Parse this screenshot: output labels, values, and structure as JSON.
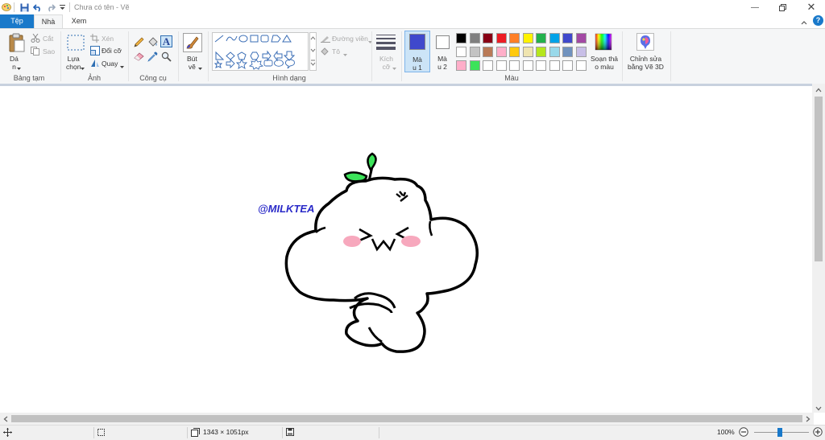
{
  "app": {
    "title": "Chưa có tên - Vẽ",
    "tabs": [
      "Tệp",
      "Nhà",
      "Xem"
    ]
  },
  "ribbon": {
    "clipboard": {
      "paste": "Dá\nn",
      "cut": "Cắt",
      "copy": "Sao",
      "group": "Bảng tạm"
    },
    "image": {
      "select": "Lựa\nchọn",
      "crop": "Xén",
      "resize": "Đổi cỡ",
      "rotate": "Quay",
      "group": "Ảnh"
    },
    "tools": {
      "group": "Công cụ"
    },
    "brushes": {
      "label": "Bút\nvẽ"
    },
    "shapes": {
      "outline": "Đường viền",
      "fill": "Tô",
      "group": "Hình dạng"
    },
    "size": {
      "label": "Kích\ncỡ"
    },
    "colors": {
      "color1_label": "Mà\nu 1",
      "color2_label": "Mà\nu 2",
      "edit_label": "Soạn thả\no màu",
      "group": "Màu",
      "color1": "#3f48cc",
      "color2": "#ffffff",
      "palette_row1": [
        "#000000",
        "#7f7f7f",
        "#880015",
        "#ed1c24",
        "#ff7f27",
        "#fff200",
        "#22b14c",
        "#00a2e8",
        "#3f48cc",
        "#a349a4"
      ],
      "palette_row2": [
        "#ffffff",
        "#c3c3c3",
        "#b97a57",
        "#ffaec9",
        "#ffc90e",
        "#efe4b0",
        "#b5e61d",
        "#99d9ea",
        "#7092be",
        "#c8bfe7"
      ],
      "palette_row3": [
        "#ffaec9",
        "#3ce35a",
        "#ffffff",
        "#ffffff",
        "#ffffff",
        "#ffffff",
        "#ffffff",
        "#ffffff",
        "#ffffff",
        "#ffffff"
      ]
    },
    "paint3d": {
      "label": "Chỉnh sửa\nbằng Vẽ 3D"
    }
  },
  "canvas": {
    "watermark": "@MILKTEA"
  },
  "status": {
    "size": "1343 × 1051px",
    "zoom": "100%"
  }
}
